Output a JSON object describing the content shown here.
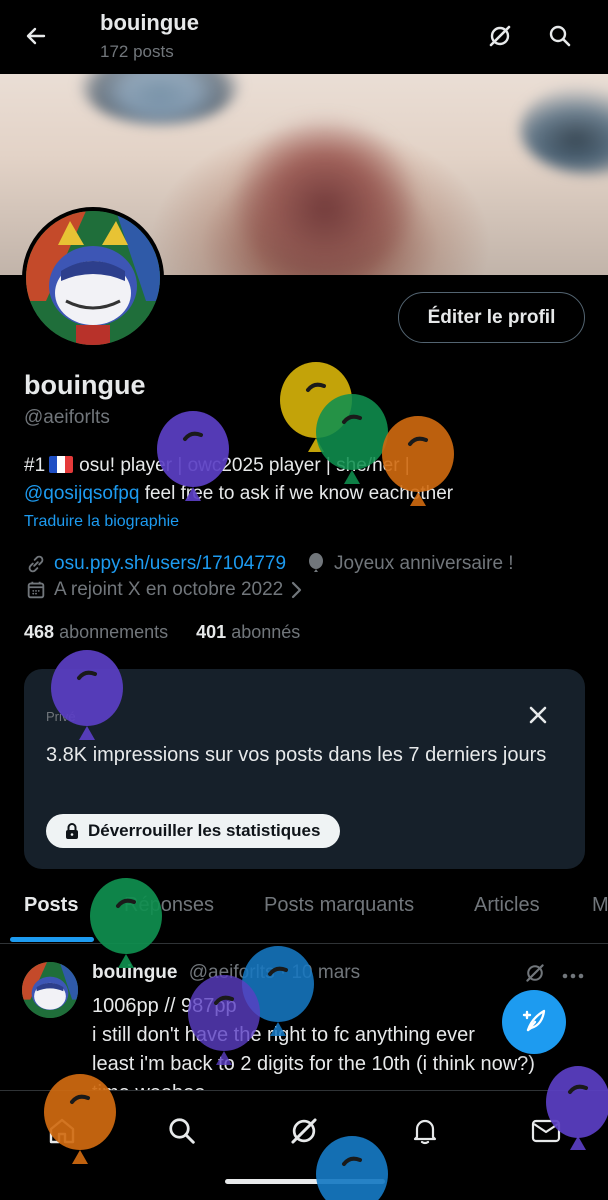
{
  "header": {
    "title": "bouingue",
    "post_count": "172 posts"
  },
  "profile": {
    "display_name": "bouingue",
    "handle": "@aeiforlts",
    "edit_button": "Éditer le profil",
    "bio": {
      "line1_prefix": "#1",
      "line1_rest": "osu! player | owc2025 player | she/her |",
      "mention": "@qosijqsofpq",
      "line2_rest": " feel free to ask if we know eachother"
    },
    "translate_link": "Traduire la biographie",
    "website": "osu.ppy.sh/users/17104779",
    "birthday": "Joyeux anniversaire !",
    "joined": "A rejoint X en octobre 2022",
    "following_count": "468",
    "following_label": "abonnements",
    "followers_count": "401",
    "followers_label": "abonnés"
  },
  "insights_card": {
    "badge": "Privé",
    "text": "3.8K impressions sur vos posts dans les 7 derniers jours",
    "unlock_button": "Déverrouiller les statistiques"
  },
  "tabs": [
    {
      "label": "Posts",
      "active": true
    },
    {
      "label": "Réponses"
    },
    {
      "label": "Posts marquants"
    },
    {
      "label": "Articles"
    },
    {
      "label": "M"
    }
  ],
  "post": {
    "author": "bouingue",
    "handle": "@aeiforlts",
    "date": "· 10 mars",
    "lines": [
      "1006pp // 987pp",
      "i still don't have the right to fc anything ever",
      "least i'm back to 2 digits for the 10th (i think now?)",
      "time woohoo"
    ]
  },
  "colors": {
    "accent": "#1d9bf0",
    "background": "#000000",
    "card": "#16202a",
    "muted": "#71767b",
    "balloon_purple": "#5b3fc4",
    "balloon_yellow": "#d4b10a",
    "balloon_green": "#0f8f4f",
    "balloon_orange": "#d06a10",
    "balloon_blue": "#1678c2"
  },
  "icons": {
    "back": "arrow-left-icon",
    "grok": "grok-icon",
    "search": "search-icon",
    "link": "link-icon",
    "balloon": "balloon-icon",
    "calendar": "calendar-icon",
    "close": "close-icon",
    "lock": "lock-icon",
    "more": "more-icon",
    "home": "home-icon",
    "bell": "bell-icon",
    "mail": "mail-icon",
    "compose": "compose-icon"
  }
}
